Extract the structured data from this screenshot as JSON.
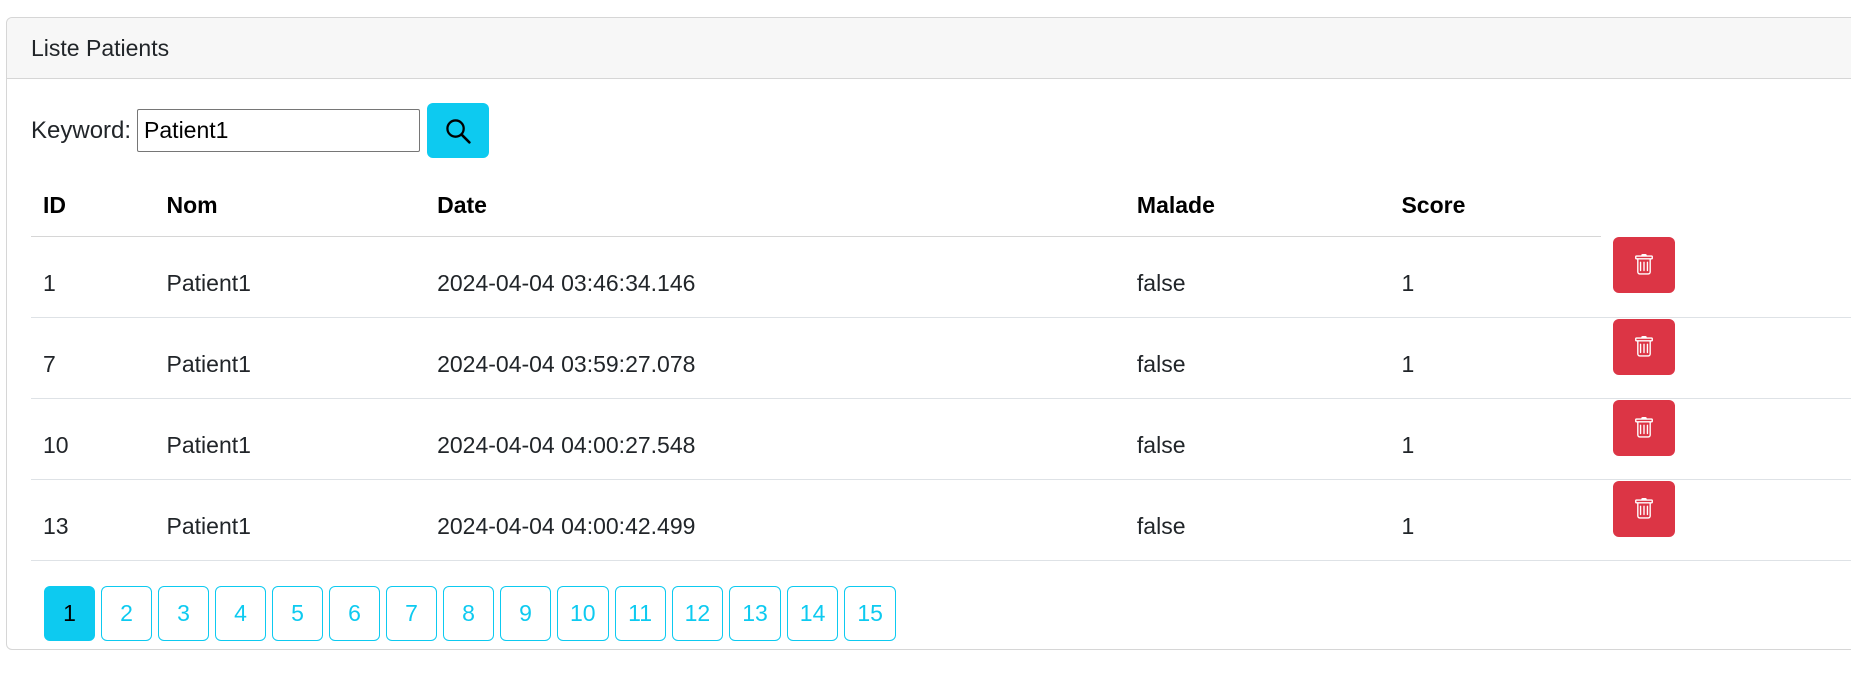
{
  "card": {
    "title": "Liste Patients"
  },
  "search": {
    "label": "Keyword:",
    "value": "Patient1",
    "icon": "search-icon"
  },
  "table": {
    "headers": {
      "id": "ID",
      "nom": "Nom",
      "date": "Date",
      "malade": "Malade",
      "score": "Score"
    },
    "rows": [
      {
        "id": "1",
        "nom": "Patient1",
        "date": "2024-04-04 03:46:34.146",
        "malade": "false",
        "score": "1"
      },
      {
        "id": "7",
        "nom": "Patient1",
        "date": "2024-04-04 03:59:27.078",
        "malade": "false",
        "score": "1"
      },
      {
        "id": "10",
        "nom": "Patient1",
        "date": "2024-04-04 04:00:27.548",
        "malade": "false",
        "score": "1"
      },
      {
        "id": "13",
        "nom": "Patient1",
        "date": "2024-04-04 04:00:42.499",
        "malade": "false",
        "score": "1"
      }
    ],
    "delete_icon": "trash-icon"
  },
  "pagination": {
    "pages": [
      "1",
      "2",
      "3",
      "4",
      "5",
      "6",
      "7",
      "8",
      "9",
      "10",
      "11",
      "12",
      "13",
      "14",
      "15"
    ],
    "current": "1"
  },
  "colors": {
    "info": "#0dcaf0",
    "danger": "#dc3545"
  }
}
